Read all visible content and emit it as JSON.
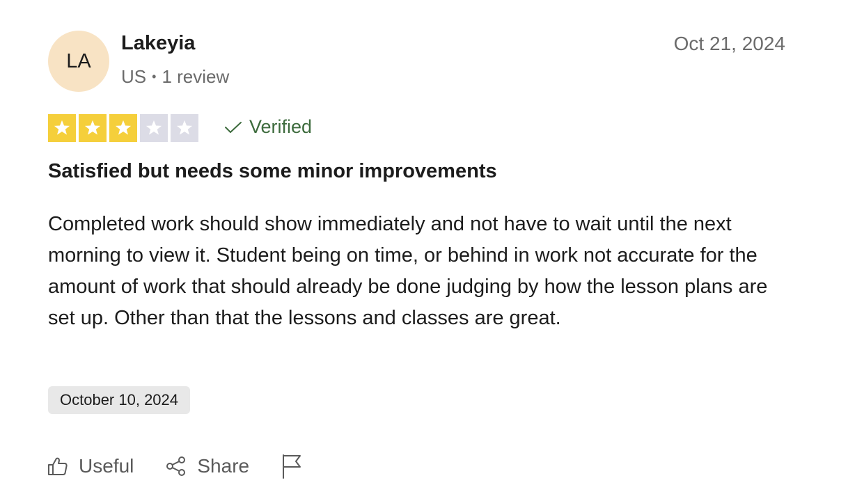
{
  "reviewer": {
    "initials": "LA",
    "name": "Lakeyia",
    "country": "US",
    "separator": "•",
    "review_count": "1 review"
  },
  "review": {
    "posted_date": "Oct 21, 2024",
    "rating": 3,
    "max_rating": 5,
    "verified_label": "Verified",
    "title": "Satisfied but needs some minor improvements",
    "body": "Completed work should show immediately and not have to wait until the next morning to view it. Student being on time, or behind in work not accurate for the amount of work that should already be done judging by how the lesson plans are set up. Other than that the lessons and classes are great.",
    "experience_date": "October 10, 2024"
  },
  "actions": {
    "useful_label": "Useful",
    "share_label": "Share"
  },
  "icons": {
    "star": "star-icon",
    "verified": "check-icon",
    "useful": "thumbs-up-icon",
    "share": "share-icon",
    "report": "flag-icon"
  },
  "colors": {
    "star_filled": "#f5cf3b",
    "star_empty": "#dcdce6",
    "avatar_bg": "#f8e3c4",
    "verified": "#3d6b3d"
  }
}
